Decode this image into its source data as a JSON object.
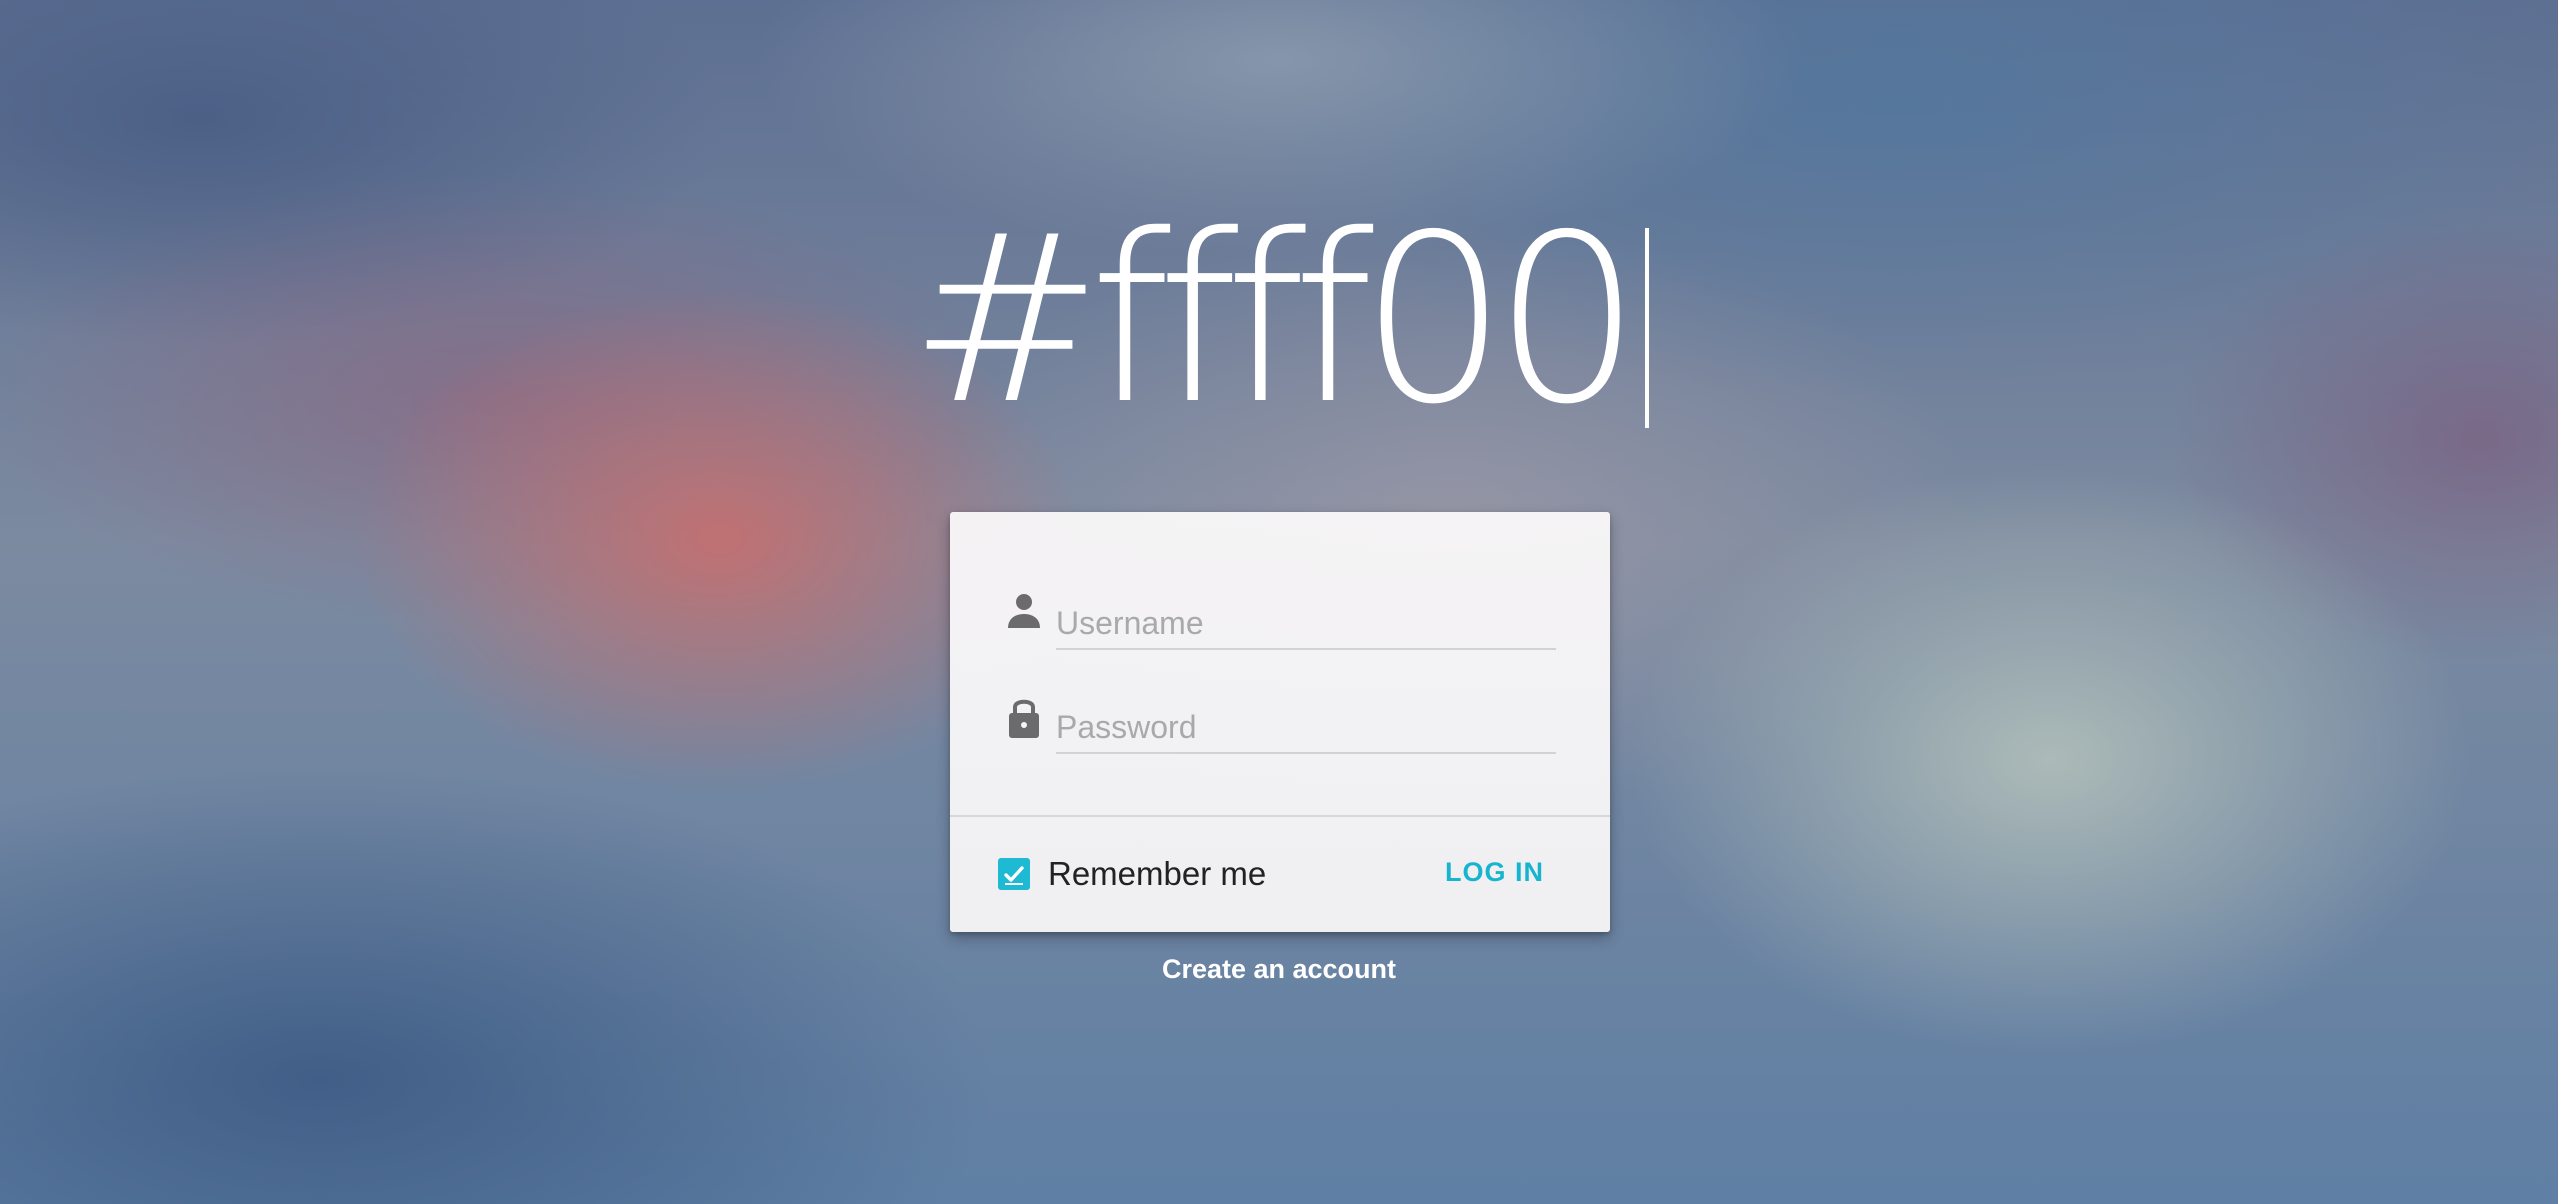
{
  "headline": {
    "text": "#ffff00"
  },
  "login_form": {
    "username": {
      "icon": "person-icon",
      "placeholder": "Username",
      "value": ""
    },
    "password": {
      "icon": "lock-icon",
      "placeholder": "Password",
      "value": ""
    },
    "remember_me": {
      "label": "Remember me",
      "checked": true
    },
    "login_button": {
      "label": "LOG IN"
    }
  },
  "create_account": {
    "label": "Create an account"
  },
  "colors": {
    "accent": "#1eb9d3",
    "headline": "#ffffff"
  }
}
